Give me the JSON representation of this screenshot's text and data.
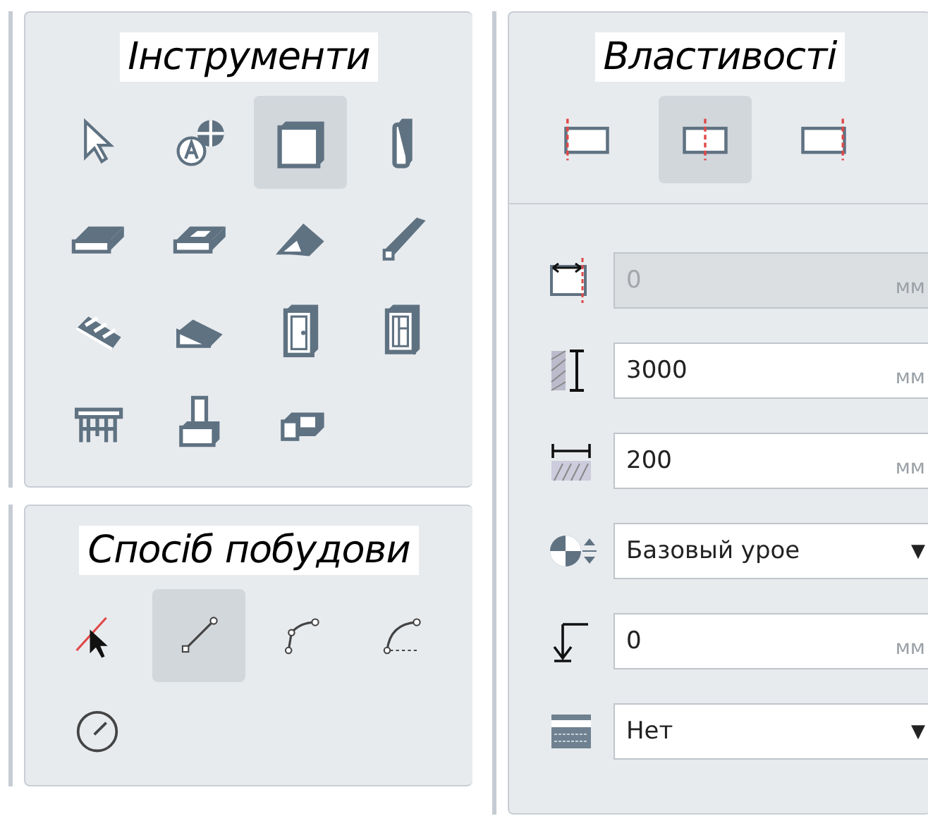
{
  "tools_panel": {
    "title": "Інструменти",
    "tools": [
      {
        "selected": false
      },
      {
        "selected": false
      },
      {
        "selected": true
      },
      {
        "selected": false
      },
      {
        "selected": false
      },
      {
        "selected": false
      },
      {
        "selected": false
      },
      {
        "selected": false
      },
      {
        "selected": false
      },
      {
        "selected": false
      },
      {
        "selected": false
      },
      {
        "selected": false
      },
      {
        "selected": false
      },
      {
        "selected": false
      },
      {
        "selected": false
      }
    ]
  },
  "method_panel": {
    "title": "Спосіб побудови",
    "methods": [
      {
        "selected": false
      },
      {
        "selected": true
      },
      {
        "selected": false
      },
      {
        "selected": false
      },
      {
        "selected": false
      }
    ]
  },
  "properties_panel": {
    "title": "Властивості",
    "alignment": [
      {
        "selected": false
      },
      {
        "selected": true
      },
      {
        "selected": false
      }
    ],
    "fields": [
      {
        "kind": "number",
        "value": "0",
        "unit": "мм",
        "disabled": true
      },
      {
        "kind": "number",
        "value": "3000",
        "unit": "мм",
        "disabled": false
      },
      {
        "kind": "number",
        "value": "200",
        "unit": "мм",
        "disabled": false
      },
      {
        "kind": "select",
        "value": "Базовый урое",
        "arrow": "▼",
        "disabled": false
      },
      {
        "kind": "number",
        "value": "0",
        "unit": "мм",
        "disabled": false
      },
      {
        "kind": "select",
        "value": "Нет",
        "arrow": "▼",
        "disabled": false
      }
    ]
  }
}
